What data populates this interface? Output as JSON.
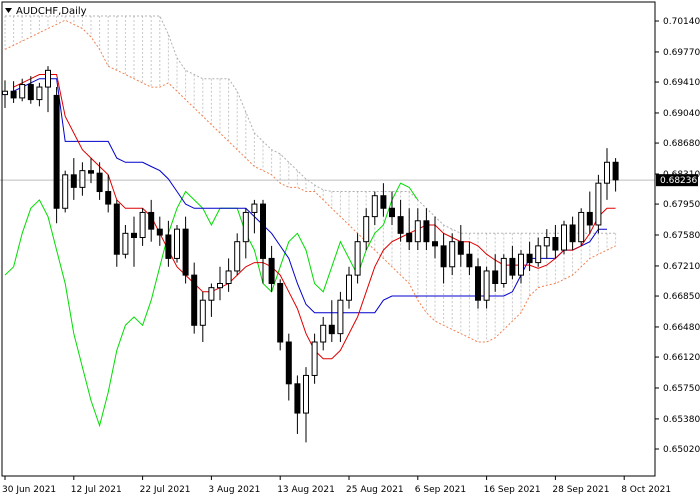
{
  "chart_data": {
    "type": "line",
    "title": "AUDCHF,Daily",
    "current_price": "0.68236",
    "ylim": [
      0.6502,
      0.702
    ],
    "yticks": [
      "0.70140",
      "0.69770",
      "0.69410",
      "0.69040",
      "0.68680",
      "0.68310",
      "0.67950",
      "0.67580",
      "0.67210",
      "0.66850",
      "0.66480",
      "0.66120",
      "0.65750",
      "0.65380",
      "0.65020"
    ],
    "xticks": [
      {
        "label": "30 Jun 2021",
        "i": 0
      },
      {
        "label": "12 Jul 2021",
        "i": 8
      },
      {
        "label": "22 Jul 2021",
        "i": 16
      },
      {
        "label": "3 Aug 2021",
        "i": 24
      },
      {
        "label": "13 Aug 2021",
        "i": 32
      },
      {
        "label": "25 Aug 2021",
        "i": 40
      },
      {
        "label": "6 Sep 2021",
        "i": 48
      },
      {
        "label": "16 Sep 2021",
        "i": 56
      },
      {
        "label": "28 Sep 2021",
        "i": 64
      },
      {
        "label": "8 Oct 2021",
        "i": 72
      }
    ],
    "candles": [
      [
        0.6926,
        0.6943,
        0.691,
        0.693
      ],
      [
        0.693,
        0.6942,
        0.6916,
        0.6922
      ],
      [
        0.6922,
        0.6945,
        0.6918,
        0.6938
      ],
      [
        0.6938,
        0.6948,
        0.6915,
        0.692
      ],
      [
        0.692,
        0.694,
        0.6912,
        0.6935
      ],
      [
        0.6935,
        0.696,
        0.6905,
        0.6955
      ],
      [
        0.6925,
        0.6935,
        0.6772,
        0.679
      ],
      [
        0.679,
        0.6835,
        0.6785,
        0.683
      ],
      [
        0.683,
        0.685,
        0.68,
        0.6815
      ],
      [
        0.6815,
        0.6845,
        0.6805,
        0.6835
      ],
      [
        0.6835,
        0.685,
        0.682,
        0.6832
      ],
      [
        0.6832,
        0.6845,
        0.68,
        0.681
      ],
      [
        0.681,
        0.683,
        0.6785,
        0.6795
      ],
      [
        0.6795,
        0.68,
        0.672,
        0.6735
      ],
      [
        0.6735,
        0.677,
        0.673,
        0.676
      ],
      [
        0.676,
        0.678,
        0.672,
        0.6755
      ],
      [
        0.6755,
        0.679,
        0.6745,
        0.6785
      ],
      [
        0.6785,
        0.68,
        0.675,
        0.6765
      ],
      [
        0.6765,
        0.678,
        0.6745,
        0.6758
      ],
      [
        0.6758,
        0.6775,
        0.672,
        0.673
      ],
      [
        0.673,
        0.677,
        0.6725,
        0.6765
      ],
      [
        0.6765,
        0.678,
        0.67,
        0.671
      ],
      [
        0.671,
        0.6725,
        0.664,
        0.665
      ],
      [
        0.665,
        0.669,
        0.663,
        0.668
      ],
      [
        0.668,
        0.67,
        0.666,
        0.6695
      ],
      [
        0.6695,
        0.672,
        0.668,
        0.67
      ],
      [
        0.67,
        0.673,
        0.669,
        0.6715
      ],
      [
        0.6715,
        0.676,
        0.671,
        0.675
      ],
      [
        0.675,
        0.679,
        0.673,
        0.6785
      ],
      [
        0.6785,
        0.68,
        0.676,
        0.6795
      ],
      [
        0.6795,
        0.68,
        0.67,
        0.673
      ],
      [
        0.673,
        0.6745,
        0.669,
        0.67
      ],
      [
        0.67,
        0.6705,
        0.662,
        0.663
      ],
      [
        0.663,
        0.664,
        0.656,
        0.658
      ],
      [
        0.658,
        0.659,
        0.652,
        0.6545
      ],
      [
        0.6545,
        0.66,
        0.651,
        0.659
      ],
      [
        0.659,
        0.664,
        0.658,
        0.663
      ],
      [
        0.663,
        0.666,
        0.662,
        0.665
      ],
      [
        0.665,
        0.668,
        0.663,
        0.664
      ],
      [
        0.664,
        0.669,
        0.663,
        0.668
      ],
      [
        0.668,
        0.672,
        0.667,
        0.671
      ],
      [
        0.671,
        0.676,
        0.67,
        0.675
      ],
      [
        0.675,
        0.679,
        0.674,
        0.678
      ],
      [
        0.678,
        0.681,
        0.677,
        0.6805
      ],
      [
        0.6805,
        0.682,
        0.678,
        0.679
      ],
      [
        0.679,
        0.681,
        0.677,
        0.678
      ],
      [
        0.678,
        0.68,
        0.675,
        0.676
      ],
      [
        0.676,
        0.679,
        0.674,
        0.675
      ],
      [
        0.675,
        0.679,
        0.674,
        0.6775
      ],
      [
        0.6775,
        0.679,
        0.674,
        0.675
      ],
      [
        0.675,
        0.678,
        0.673,
        0.6745
      ],
      [
        0.6745,
        0.676,
        0.67,
        0.672
      ],
      [
        0.672,
        0.676,
        0.671,
        0.675
      ],
      [
        0.675,
        0.677,
        0.672,
        0.6735
      ],
      [
        0.6735,
        0.675,
        0.671,
        0.672
      ],
      [
        0.672,
        0.673,
        0.667,
        0.668
      ],
      [
        0.668,
        0.672,
        0.667,
        0.6715
      ],
      [
        0.6715,
        0.6735,
        0.669,
        0.67
      ],
      [
        0.67,
        0.6735,
        0.6695,
        0.673
      ],
      [
        0.673,
        0.6745,
        0.6705,
        0.671
      ],
      [
        0.671,
        0.674,
        0.67,
        0.6735
      ],
      [
        0.6735,
        0.675,
        0.6715,
        0.6725
      ],
      [
        0.6725,
        0.6755,
        0.672,
        0.6745
      ],
      [
        0.6745,
        0.6765,
        0.673,
        0.6755
      ],
      [
        0.6755,
        0.677,
        0.673,
        0.674
      ],
      [
        0.674,
        0.6775,
        0.6735,
        0.677
      ],
      [
        0.677,
        0.678,
        0.674,
        0.675
      ],
      [
        0.675,
        0.679,
        0.6745,
        0.6785
      ],
      [
        0.6785,
        0.681,
        0.676,
        0.677
      ],
      [
        0.677,
        0.683,
        0.676,
        0.682
      ],
      [
        0.682,
        0.6862,
        0.68,
        0.6845
      ],
      [
        0.6845,
        0.685,
        0.681,
        0.6824
      ]
    ],
    "tenkan": [
      0.6935,
      0.694,
      0.6945,
      0.695,
      0.695,
      0.695,
      0.69,
      0.688,
      0.686,
      0.685,
      0.684,
      0.683,
      0.68,
      0.679,
      0.679,
      0.679,
      0.678,
      0.676,
      0.674,
      0.672,
      0.671,
      0.67,
      0.669,
      0.669,
      0.6695,
      0.67,
      0.671,
      0.672,
      0.6725,
      0.6725,
      0.672,
      0.671,
      0.669,
      0.667,
      0.664,
      0.662,
      0.661,
      0.661,
      0.662,
      0.664,
      0.666,
      0.669,
      0.672,
      0.674,
      0.675,
      0.6755,
      0.676,
      0.6765,
      0.677,
      0.677,
      0.676,
      0.6755,
      0.675,
      0.675,
      0.6745,
      0.6735,
      0.6728,
      0.6722,
      0.6722,
      0.6722,
      0.6722,
      0.6718,
      0.6722,
      0.673,
      0.674,
      0.674,
      0.6745,
      0.676,
      0.678,
      0.679,
      0.679
    ],
    "kijun": [
      0.693,
      0.6935,
      0.694,
      0.6945,
      0.6945,
      0.6945,
      0.687,
      0.687,
      0.687,
      0.687,
      0.687,
      0.687,
      0.685,
      0.6845,
      0.6845,
      0.6845,
      0.684,
      0.6835,
      0.6825,
      0.681,
      0.6795,
      0.679,
      0.679,
      0.679,
      0.679,
      0.679,
      0.679,
      0.679,
      0.678,
      0.677,
      0.676,
      0.6745,
      0.673,
      0.67,
      0.6675,
      0.6665,
      0.6665,
      0.6665,
      0.6665,
      0.6665,
      0.6665,
      0.6665,
      0.6665,
      0.668,
      0.6685,
      0.6685,
      0.6685,
      0.6685,
      0.6685,
      0.6685,
      0.6685,
      0.6685,
      0.6685,
      0.6685,
      0.6685,
      0.6685,
      0.6685,
      0.6685,
      0.669,
      0.671,
      0.673,
      0.673,
      0.673,
      0.673,
      0.674,
      0.674,
      0.6745,
      0.675,
      0.6765,
      0.6765
    ],
    "chikou": [
      0.671,
      0.672,
      0.676,
      0.679,
      0.68,
      0.678,
      0.674,
      0.67,
      0.664,
      0.66,
      0.656,
      0.653,
      0.657,
      0.662,
      0.665,
      0.666,
      0.665,
      0.668,
      0.672,
      0.676,
      0.679,
      0.681,
      0.68,
      0.679,
      0.677,
      0.679,
      0.679,
      0.679,
      0.676,
      0.674,
      0.67,
      0.669,
      0.672,
      0.675,
      0.676,
      0.674,
      0.67,
      0.669,
      0.672,
      0.675,
      0.673,
      0.671,
      0.674,
      0.676,
      0.677,
      0.68,
      0.682,
      0.6815,
      0.68
    ],
    "span_a": [
      0.698,
      0.6985,
      0.699,
      0.6995,
      0.7,
      0.7005,
      0.701,
      0.7015,
      0.701,
      0.7005,
      0.6995,
      0.698,
      0.696,
      0.6955,
      0.695,
      0.6945,
      0.694,
      0.6935,
      0.6935,
      0.694,
      0.693,
      0.692,
      0.691,
      0.69,
      0.689,
      0.688,
      0.687,
      0.686,
      0.685,
      0.684,
      0.6835,
      0.683,
      0.682,
      0.6815,
      0.6815,
      0.681,
      0.681,
      0.68,
      0.679,
      0.678,
      0.677,
      0.676,
      0.675,
      0.674,
      0.673,
      0.672,
      0.671,
      0.67,
      0.668,
      0.6665,
      0.6655,
      0.665,
      0.6645,
      0.664,
      0.6635,
      0.663,
      0.663,
      0.6635,
      0.6645,
      0.6655,
      0.6665,
      0.6685,
      0.6695,
      0.6698,
      0.67,
      0.6705,
      0.671,
      0.672,
      0.673,
      0.6735,
      0.674,
      0.6745
    ],
    "span_b": [
      0.702,
      0.702,
      0.702,
      0.702,
      0.702,
      0.702,
      0.702,
      0.702,
      0.702,
      0.702,
      0.702,
      0.702,
      0.702,
      0.702,
      0.702,
      0.702,
      0.702,
      0.702,
      0.702,
      0.6998,
      0.697,
      0.6955,
      0.695,
      0.6945,
      0.6945,
      0.6945,
      0.6945,
      0.693,
      0.6905,
      0.688,
      0.687,
      0.686,
      0.6855,
      0.6845,
      0.6835,
      0.6825,
      0.6818,
      0.6812,
      0.681,
      0.681,
      0.681,
      0.681,
      0.681,
      0.681,
      0.681,
      0.681,
      0.681,
      0.681,
      0.68,
      0.679,
      0.678,
      0.677,
      0.6765,
      0.676,
      0.676,
      0.676,
      0.676,
      0.676,
      0.676,
      0.676,
      0.676,
      0.676,
      0.676,
      0.676,
      0.676,
      0.676,
      0.676,
      0.676,
      0.676,
      0.676,
      0.676,
      0.676
    ]
  }
}
